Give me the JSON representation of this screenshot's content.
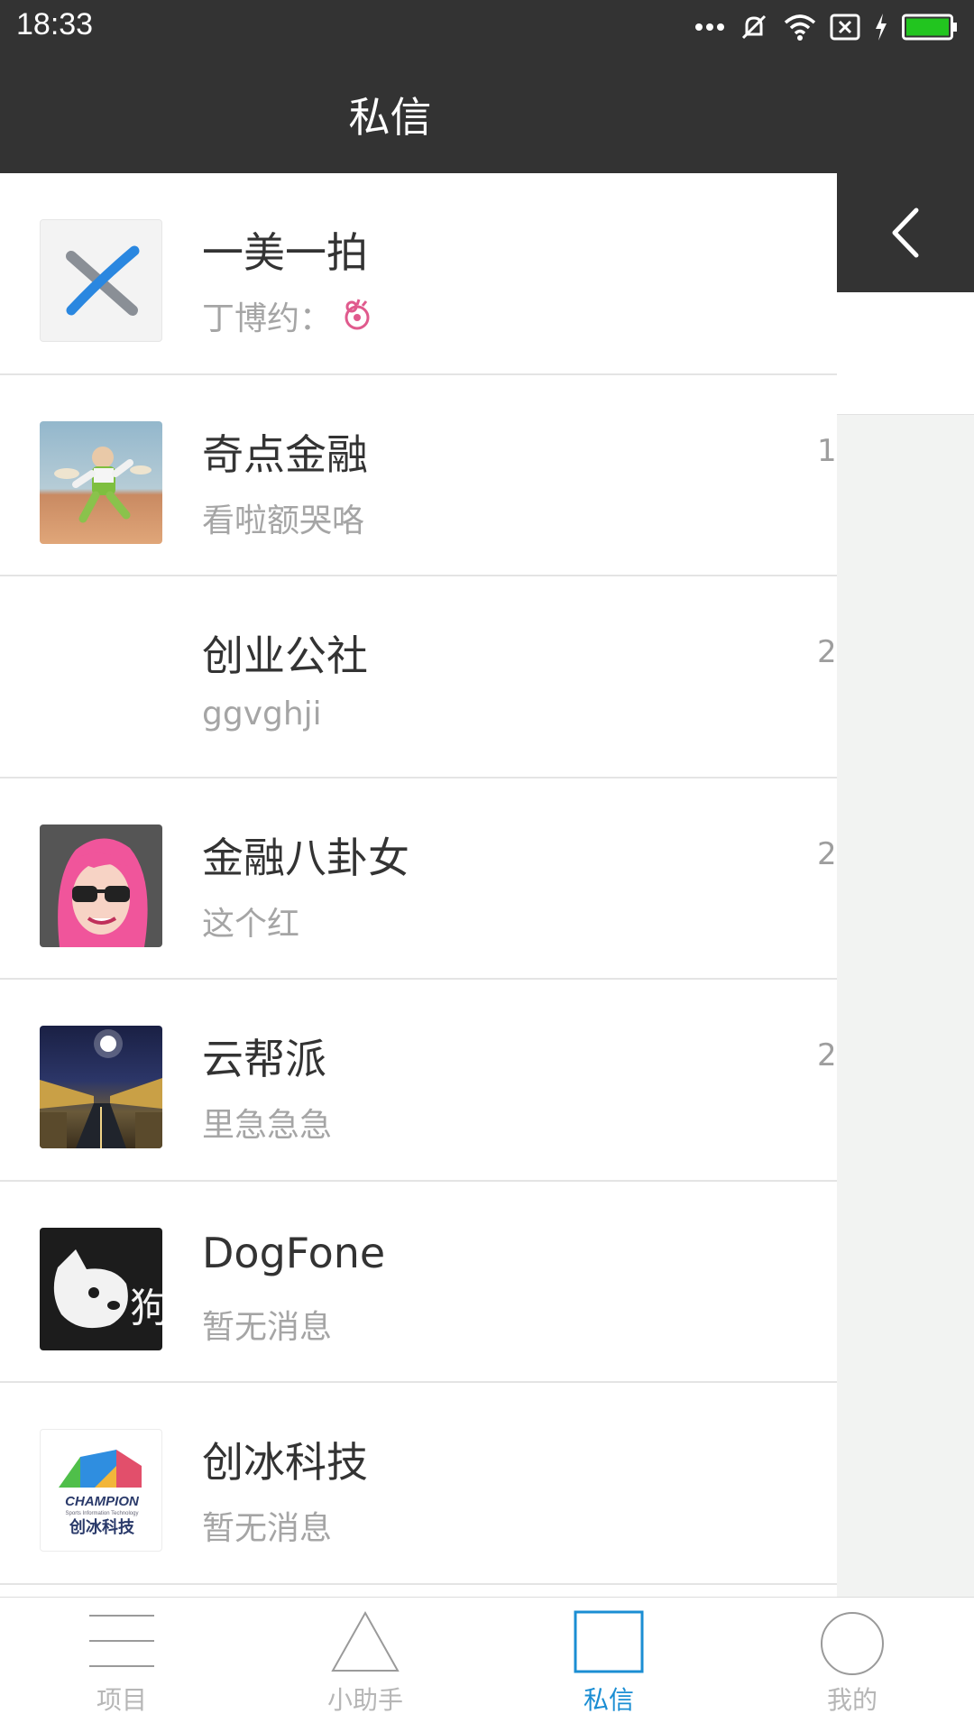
{
  "status_bar": {
    "time": "18:33"
  },
  "header": {
    "title": "私信"
  },
  "conversations": [
    {
      "name": "一美一拍",
      "preview": "丁博约：",
      "time": ""
    },
    {
      "name": "奇点金融",
      "preview": "看啦额哭咯",
      "time": "1"
    },
    {
      "name": "创业公社",
      "preview": "ggvghji",
      "time": "2"
    },
    {
      "name": "金融八卦女",
      "preview": "这个红",
      "time": "2"
    },
    {
      "name": "云帮派",
      "preview": "里急急急",
      "time": "2"
    },
    {
      "name": "DogFone",
      "preview": "暂无消息",
      "time": ""
    },
    {
      "name": "创冰科技",
      "preview": "暂无消息",
      "time": ""
    }
  ],
  "avatar_texts": {
    "dog": "狗",
    "champion": "CHAMPION",
    "champion_sub": "Sports Information Technology",
    "champion_cn": "创冰科技"
  },
  "tabs": [
    {
      "label": "项目",
      "icon": "menu-icon"
    },
    {
      "label": "小助手",
      "icon": "triangle-icon"
    },
    {
      "label": "私信",
      "icon": "square-icon"
    },
    {
      "label": "我的",
      "icon": "circle-icon"
    }
  ],
  "active_tab": "私信",
  "colors": {
    "bar": "#333333",
    "accent": "#1b8ed3",
    "inactive": "#b6b6b6"
  }
}
